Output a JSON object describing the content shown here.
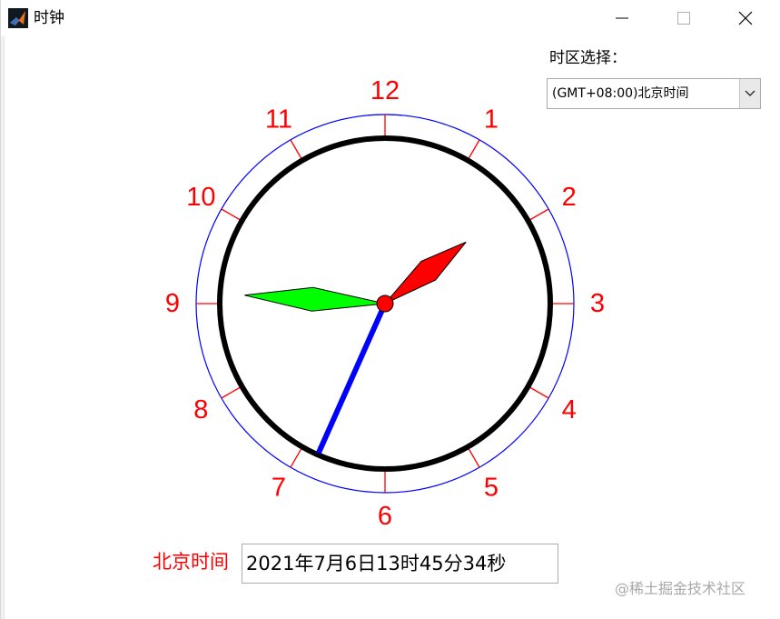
{
  "window": {
    "title": "时钟",
    "controls": [
      "minimize-icon",
      "maximize-icon",
      "close-icon"
    ]
  },
  "timezone": {
    "label": "时区选择：",
    "selected": "(GMT+08:00)北京时间"
  },
  "clock": {
    "dial_numbers": [
      "12",
      "1",
      "2",
      "3",
      "4",
      "5",
      "6",
      "7",
      "8",
      "9",
      "10",
      "11"
    ],
    "time": {
      "hour": 13,
      "minute": 45,
      "second": 34
    },
    "colors": {
      "numbers": "#ff0000",
      "ticks": "#ff0000",
      "outer_ring": "#0000ff",
      "inner_ring": "#000000",
      "hour_hand": "#ff0000",
      "minute_hand": "#00ff00",
      "second_hand": "#0000ff",
      "center": "#ff0000"
    }
  },
  "bottom": {
    "label": "北京时间",
    "time_text": "2021年7月6日13时45分34秒"
  },
  "watermark": "@稀土掘金技术社区"
}
